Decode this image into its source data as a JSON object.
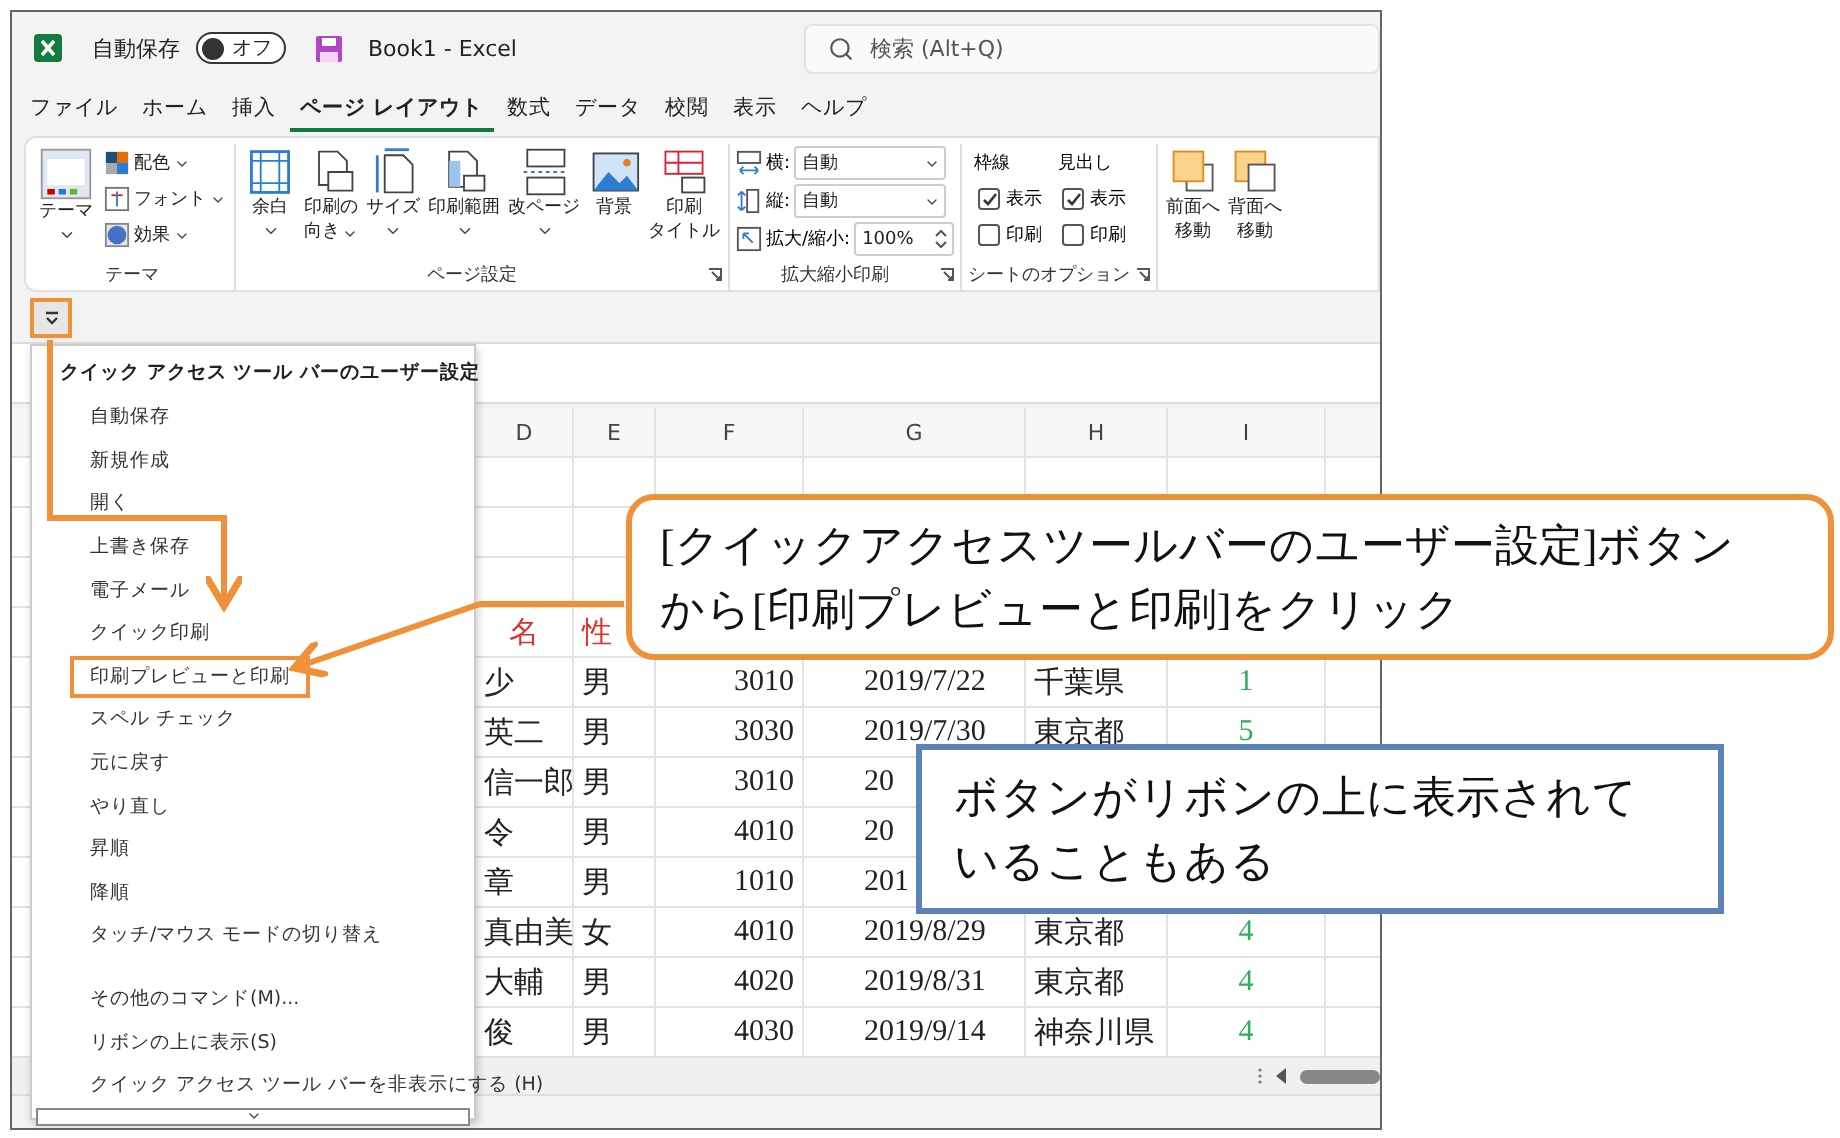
{
  "title_bar": {
    "autosave_label": "自動保存",
    "autosave_toggle": {
      "label": "オフ",
      "on": false
    },
    "document_title": "Book1 - Excel",
    "search": {
      "placeholder": "検索 (Alt+Q)"
    }
  },
  "tabs": [
    {
      "label": "ファイル",
      "selected": false
    },
    {
      "label": "ホーム",
      "selected": false
    },
    {
      "label": "挿入",
      "selected": false
    },
    {
      "label": "ページ レイアウト",
      "selected": true
    },
    {
      "label": "数式",
      "selected": false
    },
    {
      "label": "データ",
      "selected": false
    },
    {
      "label": "校閲",
      "selected": false
    },
    {
      "label": "表示",
      "selected": false
    },
    {
      "label": "ヘルプ",
      "selected": false
    }
  ],
  "ribbon": {
    "theme_group": {
      "label": "テーマ",
      "big_button": {
        "label": "テーマ"
      },
      "small_buttons": [
        {
          "label": "配色"
        },
        {
          "label": "フォント"
        },
        {
          "label": "効果"
        }
      ]
    },
    "page_setup_group": {
      "label": "ページ設定",
      "buttons": [
        {
          "lines": [
            "余白"
          ]
        },
        {
          "lines": [
            "印刷の",
            "向き"
          ]
        },
        {
          "lines": [
            "サイズ"
          ]
        },
        {
          "lines": [
            "印刷範囲"
          ]
        },
        {
          "lines": [
            "改ページ"
          ]
        },
        {
          "lines": [
            "背景"
          ],
          "dropdown": false
        },
        {
          "lines": [
            "印刷",
            "タイトル"
          ],
          "dropdown": false
        }
      ]
    },
    "scale_group": {
      "label": "拡大縮小印刷",
      "fields": [
        {
          "kind": "dropdown",
          "label": "横:",
          "value": "自動"
        },
        {
          "kind": "dropdown",
          "label": "縦:",
          "value": "自動"
        },
        {
          "kind": "spinner",
          "label": "拡大/縮小:",
          "value": "100%"
        }
      ]
    },
    "sheet_options_group": {
      "label": "シートのオプション",
      "columns": [
        {
          "heading": "枠線",
          "options": [
            {
              "label": "表示",
              "checked": true
            },
            {
              "label": "印刷",
              "checked": false
            }
          ]
        },
        {
          "heading": "見出し",
          "options": [
            {
              "label": "表示",
              "checked": true
            },
            {
              "label": "印刷",
              "checked": false
            }
          ]
        }
      ]
    },
    "arrange_group": {
      "buttons": [
        {
          "lines": [
            "前面へ",
            "移動"
          ]
        },
        {
          "lines": [
            "背面へ",
            "移動"
          ]
        }
      ]
    }
  },
  "sheet": {
    "columns": [
      "D",
      "E",
      "F",
      "G",
      "H",
      "I"
    ],
    "rows": [
      {
        "kind": "blank"
      },
      {
        "kind": "blank"
      },
      {
        "kind": "blank"
      },
      {
        "kind": "header",
        "cells": [
          "名",
          "性"
        ]
      },
      {
        "kind": "data",
        "cells": [
          "少",
          "男",
          "3010",
          "2019/7/22",
          "千葉県",
          "1"
        ]
      },
      {
        "kind": "data",
        "cells": [
          "英二",
          "男",
          "3030",
          "2019/7/30",
          "東京都",
          "5"
        ]
      },
      {
        "kind": "data",
        "cells": [
          "信一郎",
          "男",
          "3010",
          "20"
        ]
      },
      {
        "kind": "data",
        "cells": [
          "令",
          "男",
          "4010",
          "20"
        ]
      },
      {
        "kind": "data",
        "cells": [
          "章",
          "男",
          "1010",
          "201"
        ]
      },
      {
        "kind": "data",
        "cells": [
          "真由美",
          "女",
          "4010",
          "2019/8/29",
          "東京都",
          "4"
        ]
      },
      {
        "kind": "data",
        "cells": [
          "大輔",
          "男",
          "4020",
          "2019/8/31",
          "東京都",
          "4"
        ]
      },
      {
        "kind": "data",
        "cells": [
          "俊",
          "男",
          "4030",
          "2019/9/14",
          "神奈川県",
          "4"
        ]
      }
    ]
  },
  "qat_menu": {
    "title": "クイック アクセス ツール バーのユーザー設定",
    "items": [
      {
        "label": "自動保存",
        "highlighted": false
      },
      {
        "label": "新規作成",
        "highlighted": false
      },
      {
        "label": "開く",
        "highlighted": false
      },
      {
        "label": "上書き保存",
        "highlighted": false
      },
      {
        "label": "電子メール",
        "highlighted": false
      },
      {
        "label": "クイック印刷",
        "highlighted": false
      },
      {
        "label": "印刷プレビューと印刷",
        "highlighted": true
      },
      {
        "label": "スペル チェック",
        "highlighted": false
      },
      {
        "label": "元に戻す",
        "highlighted": false
      },
      {
        "label": "やり直し",
        "highlighted": false
      },
      {
        "label": "昇順",
        "highlighted": false
      },
      {
        "label": "降順",
        "highlighted": false
      },
      {
        "label": "タッチ/マウス モードの切り替え",
        "highlighted": false
      }
    ],
    "commands": [
      {
        "label": "その他のコマンド(M)..."
      },
      {
        "label": "リボンの上に表示(S)"
      },
      {
        "label": "クイック アクセス ツール バーを非表示にする (H)"
      }
    ]
  },
  "callouts": [
    {
      "kind": "rounded",
      "lines": [
        "[クイックアクセスツールバーのユーザー設定]ボタン",
        "から[印刷プレビューと印刷]をクリック"
      ]
    },
    {
      "kind": "square",
      "lines": [
        "ボタンがリボンの上に表示されて",
        "いることもある"
      ]
    }
  ]
}
